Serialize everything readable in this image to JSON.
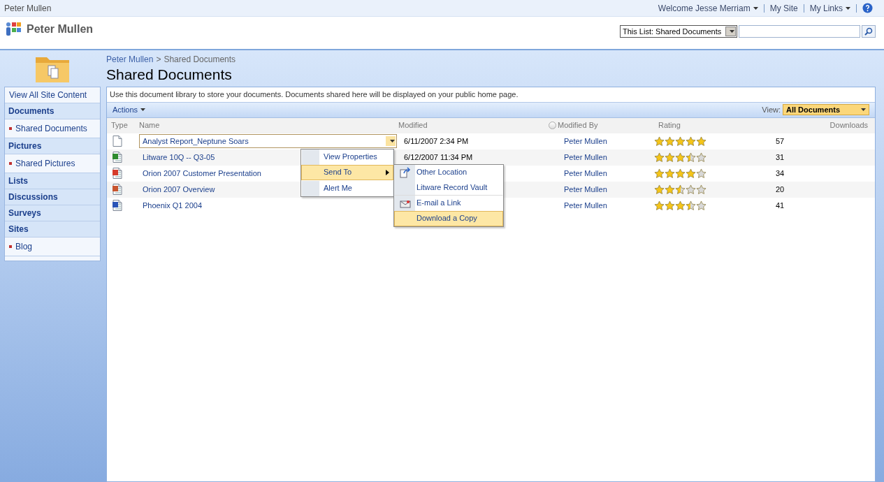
{
  "top_bar": {
    "site_name": "Peter Mullen",
    "welcome": "Welcome Jesse Merriam",
    "links": [
      "My Site",
      "My Links"
    ]
  },
  "header": {
    "title": "Peter Mullen",
    "search_scope": "This List: Shared Documents"
  },
  "breadcrumb": [
    "Peter Mullen",
    "Shared Documents"
  ],
  "breadcrumb_separator": ">",
  "page_title": "Shared Documents",
  "sidebar": {
    "view_all": "View All Site Content",
    "sections": [
      {
        "title": "Documents",
        "items": [
          {
            "label": "Shared Documents"
          }
        ]
      },
      {
        "title": "Pictures",
        "items": [
          {
            "label": "Shared Pictures"
          }
        ]
      },
      {
        "title": "Lists"
      },
      {
        "title": "Discussions"
      },
      {
        "title": "Surveys"
      },
      {
        "title": "Sites",
        "items": [
          {
            "label": "Blog"
          }
        ]
      }
    ]
  },
  "description": "Use this document library to store your documents. Documents shared here will be displayed on your public home page.",
  "toolbar": {
    "actions": "Actions",
    "view_label": "View:",
    "view": "All Documents"
  },
  "table": {
    "columns": [
      "Type",
      "Name",
      "Modified",
      "Modified By",
      "Rating",
      "Downloads"
    ],
    "rows": [
      {
        "kind": "generic",
        "name": "Analyst Report_Neptune Soars",
        "modified": "6/11/2007 2:34 PM",
        "modified_by": "Peter Mullen",
        "stars": 5,
        "downloads": "57",
        "selected": true
      },
      {
        "kind": "excel",
        "name": "Litware 10Q -- Q3-05",
        "modified": "6/12/2007 11:34 PM",
        "modified_by": "Peter Mullen",
        "stars": 3.5,
        "downloads": "31",
        "selected": false
      },
      {
        "kind": "presentation",
        "name": "Orion 2007 Customer Presentation",
        "modified_by": "Peter Mullen",
        "stars": 4,
        "downloads": "34",
        "selected": false
      },
      {
        "kind": "slides",
        "name": "Orion 2007 Overview",
        "modified_by": "Peter Mullen",
        "stars": 2.5,
        "downloads": "20",
        "selected": false
      },
      {
        "kind": "word",
        "name": "Phoenix Q1 2004",
        "modified_by": "Peter Mullen",
        "stars": 3.5,
        "downloads": "41",
        "selected": false
      }
    ]
  },
  "context_menu": {
    "items": [
      {
        "label": "View Properties",
        "selected": false,
        "submenu": false
      },
      {
        "label": "Send To",
        "selected": true,
        "submenu": true
      },
      {
        "label": "Alert Me",
        "selected": false,
        "submenu": false
      }
    ],
    "submenu": [
      {
        "label": "Other Location",
        "kind": "send",
        "selected": false
      },
      {
        "label": "Litware Record Vault",
        "kind": "plain",
        "selected": false
      },
      {
        "label": "E-mail a Link",
        "kind": "mail",
        "selected": false
      },
      {
        "label": "Download a Copy",
        "kind": "plain",
        "selected": true
      }
    ]
  }
}
